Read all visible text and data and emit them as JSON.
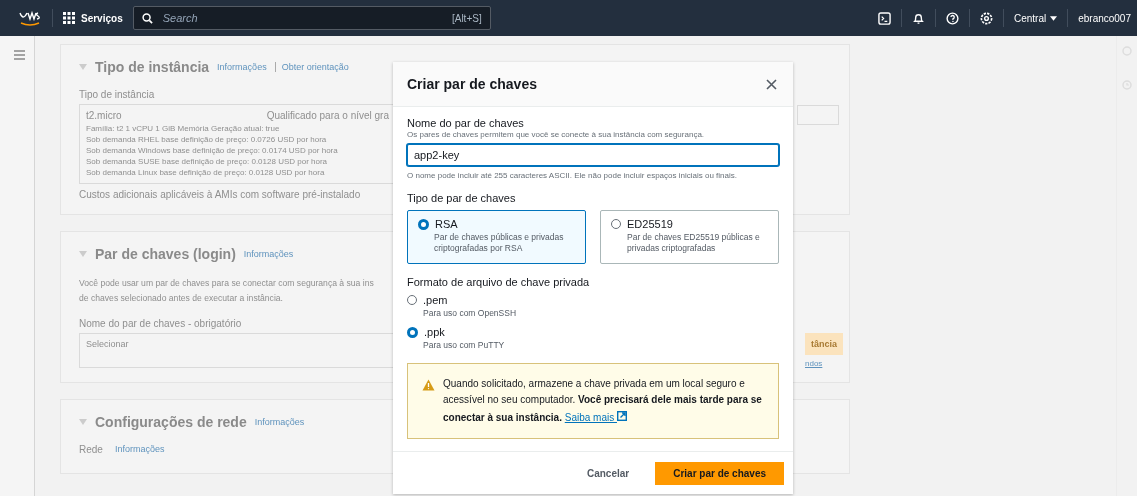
{
  "nav": {
    "services": "Serviços",
    "search_placeholder": "Search",
    "search_shortcut": "[Alt+S]",
    "region": "Central",
    "user": "ebranco007"
  },
  "background": {
    "sections": [
      {
        "kind": "instance_type",
        "title": "Tipo de instância",
        "links": [
          "Informações",
          "Obter orientação"
        ],
        "field_label": "Tipo de instância",
        "select_name": "t2.micro",
        "select_badge": "Qualificado para o nível gra",
        "details": [
          "Família: t2    1 vCPU    1 GiB Memória    Geração atual: true",
          "Sob demanda RHEL base definição de preço: 0.0726 USD por hora",
          "Sob demanda Windows base definição de preço: 0.0174 USD por hora",
          "Sob demanda SUSE base definição de preço: 0.0128 USD por hora",
          "Sob demanda Linux base definição de preço: 0.0128 USD por hora"
        ],
        "note": "Custos adicionais aplicáveis à AMIs com software pré-instalado"
      },
      {
        "kind": "key_pair",
        "title": "Par de chaves (login)",
        "links": [
          "Informações"
        ],
        "description": "Você pode usar um par de chaves para se conectar com segurança à sua ins",
        "description_2": "de chaves selecionado antes de executar a instância.",
        "field_label": "Nome do par de chaves - obrigatório",
        "select_placeholder": "Selecionar",
        "button": "tância",
        "link": "ndos"
      },
      {
        "kind": "network",
        "title": "Configurações de rede",
        "links": [
          "Informações"
        ],
        "field_label": "Rede",
        "field_link": "Informações"
      }
    ]
  },
  "modal": {
    "title": "Criar par de chaves",
    "name_field": {
      "label": "Nome do par de chaves",
      "description": "Os pares de chaves permitem que você se conecte à sua instância com segurança.",
      "value": "app2-key",
      "constraint": "O nome pode incluir até 255 caracteres ASCII. Ele não pode incluir espaços iniciais ou finais."
    },
    "key_type": {
      "label": "Tipo de par de chaves",
      "options": [
        {
          "label": "RSA",
          "description": "Par de chaves públicas e privadas criptografadas por RSA",
          "selected": true
        },
        {
          "label": "ED25519",
          "description": "Par de chaves ED25519 públicas e privadas criptografadas",
          "selected": false
        }
      ]
    },
    "format": {
      "label": "Formato de arquivo de chave privada",
      "options": [
        {
          "label": ".pem",
          "description": "Para uso com OpenSSH",
          "selected": false
        },
        {
          "label": ".ppk",
          "description": "Para uso com PuTTY",
          "selected": true
        }
      ]
    },
    "alert": {
      "text": "Quando solicitado, armazene a chave privada em um local seguro e acessível no seu computador. **Você precisará dele mais tarde para se conectar à sua instância.**",
      "link": "Saiba mais"
    },
    "cancel": "Cancelar",
    "submit": "Criar par de chaves"
  }
}
